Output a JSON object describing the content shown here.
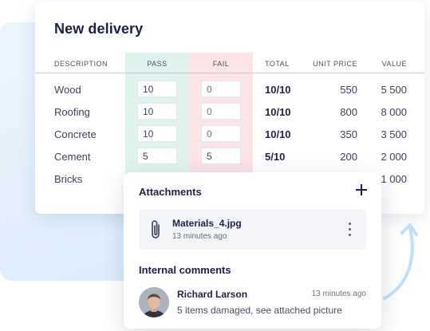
{
  "delivery": {
    "title": "New delivery",
    "columns": {
      "description": "DESCRIPTION",
      "pass": "PASS",
      "fail": "FAIL",
      "total": "TOTAL",
      "unit_price": "UNIT PRICE",
      "value": "VALUE"
    },
    "rows": [
      {
        "description": "Wood",
        "pass": "10",
        "fail": "0",
        "total": "10/10",
        "unit_price": "550",
        "value": "5 500"
      },
      {
        "description": "Roofing",
        "pass": "10",
        "fail": "0",
        "total": "10/10",
        "unit_price": "800",
        "value": "8 000"
      },
      {
        "description": "Concrete",
        "pass": "10",
        "fail": "0",
        "total": "10/10",
        "unit_price": "350",
        "value": "3 500"
      },
      {
        "description": "Cement",
        "pass": "5",
        "fail": "5",
        "total": "5/10",
        "unit_price": "200",
        "value": "2 000"
      },
      {
        "description": "Bricks",
        "value": "1 000"
      }
    ]
  },
  "attachments": {
    "title": "Attachments",
    "file": {
      "name": "Materials_4.jpg",
      "time": "13 minutes ago"
    }
  },
  "comments": {
    "title": "Internal comments",
    "author": "Richard Larson",
    "time": "13 minutes ago",
    "text": "5 items damaged, see attached picture"
  },
  "colors": {
    "pass_column": "#dff3ee",
    "fail_column": "#fbe3e6",
    "arrow": "#bfe0fb",
    "title_text": "#1d2145"
  },
  "icons": [
    "add-icon",
    "paperclip-icon",
    "more-vertical-icon",
    "curved-arrow-icon"
  ]
}
